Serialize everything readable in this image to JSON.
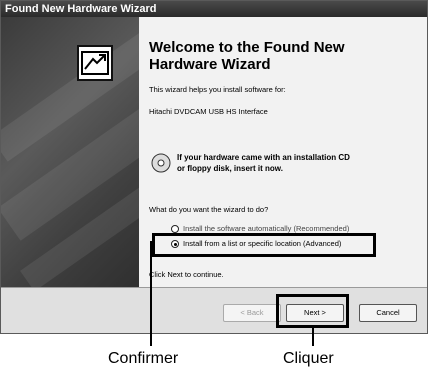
{
  "window": {
    "title": "Found New Hardware Wizard"
  },
  "content": {
    "heading": "Welcome to the Found New Hardware Wizard",
    "intro": "This wizard helps you install software for:",
    "device": "Hitachi DVDCAM USB HS Interface",
    "cd_prompt_line1": "If your hardware came with an installation CD",
    "cd_prompt_line2": "or floppy disk, insert it now.",
    "question": "What do you want the wizard to do?",
    "options": [
      {
        "label": "Install the software automatically (Recommended)",
        "selected": false
      },
      {
        "label": "Install from a list or specific location (Advanced)",
        "selected": true
      }
    ],
    "continue_text": "Click Next to continue."
  },
  "buttons": {
    "back": "< Back",
    "next": "Next >",
    "cancel": "Cancel"
  },
  "annotations": {
    "confirm": "Confirmer",
    "click": "Cliquer"
  }
}
